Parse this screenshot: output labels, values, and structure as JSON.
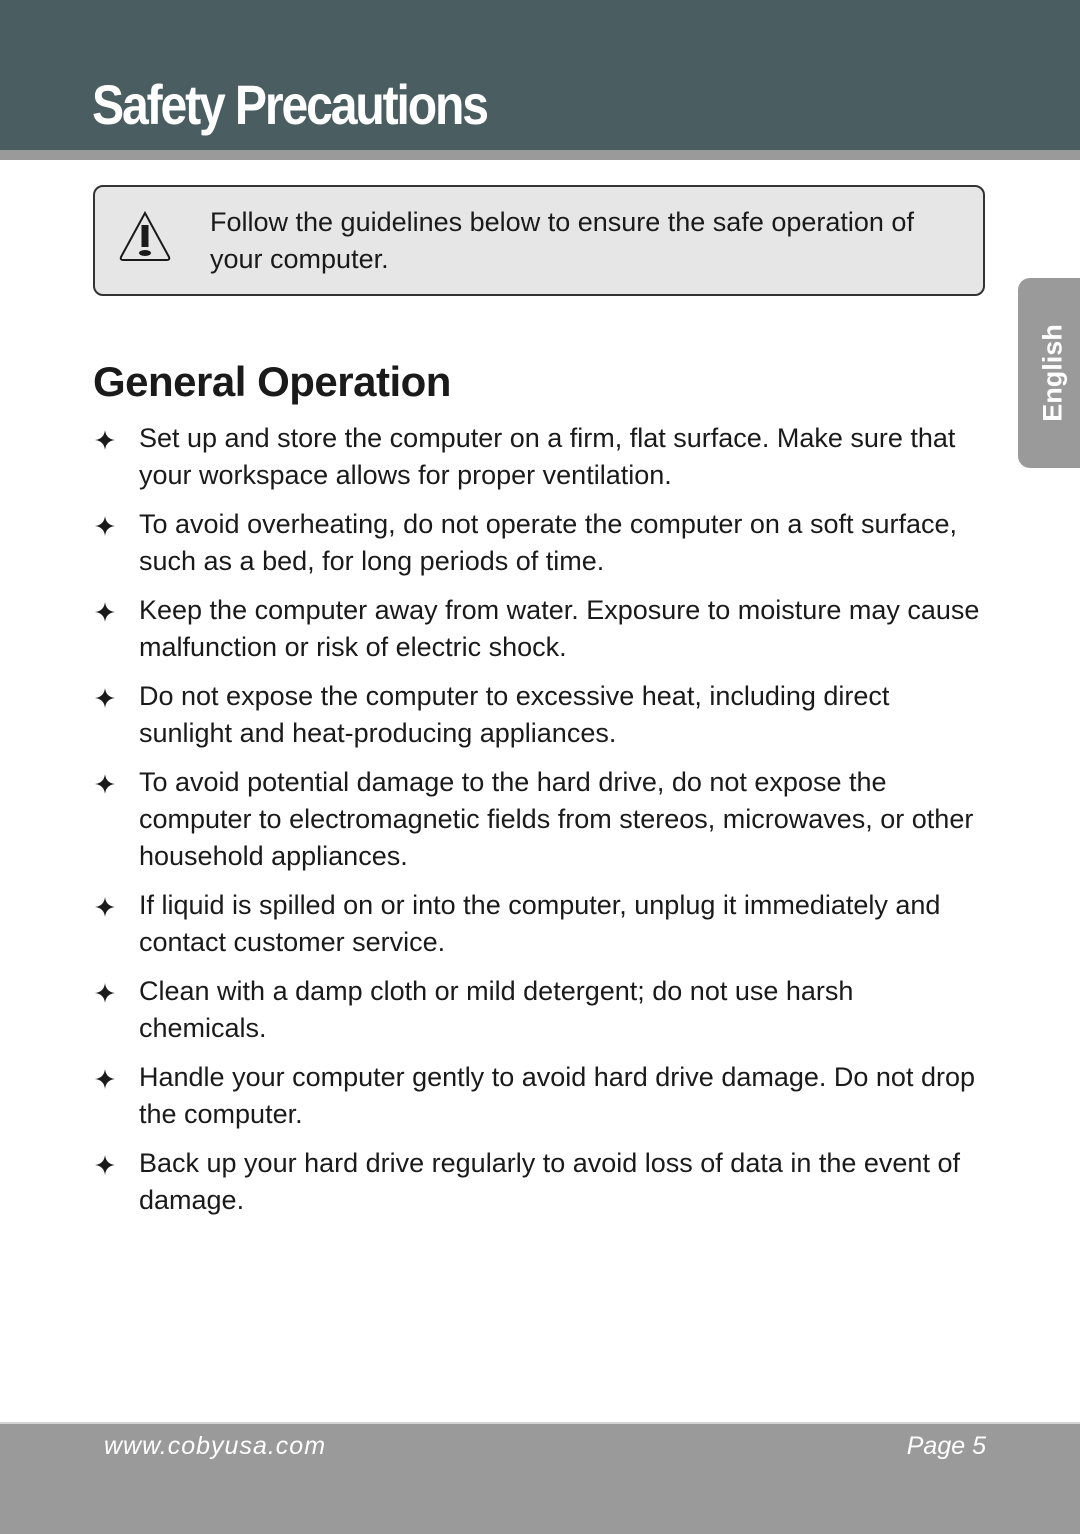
{
  "header": {
    "title": "Safety Precautions"
  },
  "notice": {
    "icon": "warning-triangle-icon",
    "text": "Follow the guidelines below to ensure the safe operation of your computer."
  },
  "language_tab": {
    "label": "English"
  },
  "section": {
    "title": "General Operation",
    "bullet_icon": "four-point-star-icon",
    "items": [
      "Set up and store the computer on a firm, flat surface. Make sure that your workspace allows for proper ventilation.",
      "To avoid overheating, do not operate the computer on a soft surface, such as a bed, for long periods of time.",
      "Keep the computer away from water. Exposure to moisture may cause malfunction or risk of electric shock.",
      "Do not expose the computer to excessive heat, including direct sunlight and heat-producing appliances.",
      "To avoid potential damage to the hard drive, do not expose the computer to electromagnetic fields from stereos, microwaves, or other household appliances.",
      "If liquid is spilled on or into the computer, unplug it immediately and contact customer service.",
      "Clean with a damp cloth or mild detergent; do not use harsh chemicals.",
      "Handle your computer gently to avoid hard drive damage. Do not drop the computer.",
      "Back up your hard drive regularly to avoid loss of data in the event of damage."
    ]
  },
  "footer": {
    "url": "www.cobyusa.com",
    "page": "Page 5"
  },
  "colors": {
    "header_bg": "#4a5d61",
    "rule_gray": "#9a9a9a",
    "notice_bg": "#e6e6e6",
    "text": "#1a1a1a"
  }
}
